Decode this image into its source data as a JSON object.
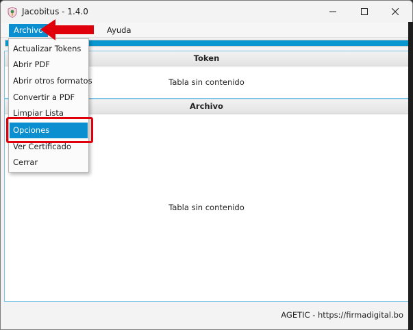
{
  "window": {
    "title": "Jacobitus - 1.4.0"
  },
  "menubar": {
    "items": [
      {
        "label": "Archivo"
      },
      {
        "label": "Ayuda"
      }
    ]
  },
  "progress": {
    "value_percent": 100,
    "color": "#0a96cf"
  },
  "token_panel": {
    "header": "Token",
    "empty_text": "Tabla sin contenido"
  },
  "archivo_panel": {
    "header": "Archivo",
    "empty_text": "Tabla sin contenido"
  },
  "footer": {
    "text": "AGETIC - https://firmadigital.bo"
  },
  "archivo_menu": {
    "items": [
      {
        "label": "Actualizar Tokens"
      },
      {
        "label": "Abrir PDF"
      },
      {
        "label": "Abrir otros formatos"
      },
      {
        "label": "Convertir a PDF"
      },
      {
        "label": "Limpiar Lista"
      },
      {
        "label": "Opciones",
        "selected": true
      },
      {
        "label": "Ver Certificado"
      },
      {
        "label": "Cerrar"
      }
    ]
  },
  "annotations": {
    "highlight_color": "#e0000b",
    "arrow_color": "#e0000b"
  },
  "colors": {
    "accent": "#0b8fd0",
    "panel_border": "#7fc4e4"
  }
}
